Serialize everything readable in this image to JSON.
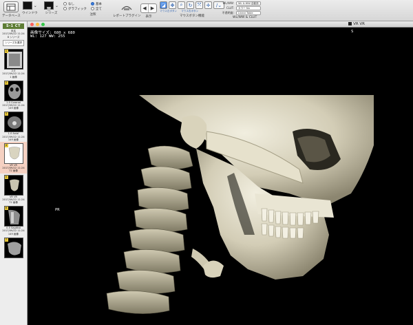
{
  "toolbar": {
    "database_label": "データベース",
    "window_label": "ウインドウ",
    "series_label": "シリーズ",
    "annotation_label": "注釈",
    "radio_none": "なし",
    "radio_graphic": "グラフィック",
    "radio_basic": "基本",
    "radio_all": "全て",
    "report_plugin_label": "レポートプラグイン",
    "nav_label": "表示",
    "mouse_label": "マウスボタン機能",
    "mouse_left": "マウス左ボタン",
    "mouse_right": "マウス右ボタン",
    "wlww_clut_label": "WL/WW & CLUT",
    "wlww_row_label": "WL/WW:",
    "wlww_value": "WL & WW 自動設",
    "clut_row_label": "CLUT:",
    "clut_value": "カラー No",
    "opacity_row_label": "不透明度:",
    "opacity_value": "Linear Table"
  },
  "sidebar": {
    "study_tag": "S-1 CT",
    "study_info": [
      "未名",
      "2017/09/22 11:24",
      "8 シリーズ"
    ],
    "series_button": "シリーズを選択",
    "series": [
      {
        "index": "1",
        "lines": [
          "2.0",
          "2017/09/22 11:24",
          "1 画像"
        ],
        "selected": false
      },
      {
        "index": "2",
        "lines": [
          "1.0 Coronal",
          "2017/09/22 11:24",
          "149 画像"
        ],
        "selected": false
      },
      {
        "index": "3",
        "lines": [
          "1.0 Axial",
          "2017/09/22 11:24",
          "149 画像"
        ],
        "selected": false
      },
      {
        "index": "4",
        "lines": [
          "VR VR",
          "2017/09/22 11:24",
          "72 画像"
        ],
        "selected": true
      },
      {
        "index": "5",
        "lines": [
          "VR VR",
          "2017/09/22 11:24",
          "72 画像"
        ],
        "selected": false
      },
      {
        "index": "6",
        "lines": [
          "0.5 Sagittal",
          "2017/09/22 11:24",
          "149 画像"
        ],
        "selected": false
      },
      {
        "index": "7",
        "lines": [],
        "selected": false
      }
    ]
  },
  "viewer": {
    "window_title": "VR VR",
    "image_size": "画像サイズ: 680 x 680",
    "wl_ww": "WL: 127 WW: 255",
    "orientation_top": "S",
    "orientation_left": "PR"
  },
  "colors": {
    "toolbar_bg": "#dcdcdc",
    "sidebar_bg": "#ededed",
    "selected_series": "#f5d1c2",
    "study_tag": "#5e7d35",
    "viewer_bg": "#000000",
    "bone": "#d9d4c0"
  }
}
